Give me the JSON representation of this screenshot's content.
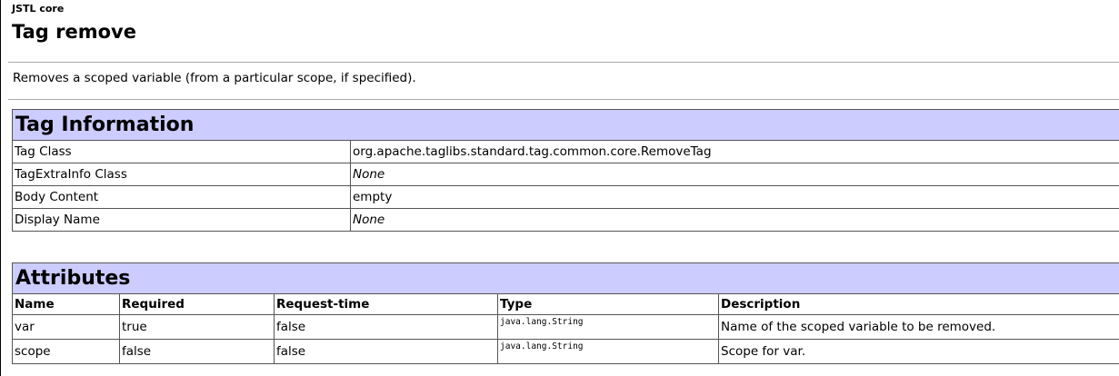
{
  "library": "JSTL core",
  "tag_title": "Tag remove",
  "description": "Removes a scoped variable (from a particular scope, if specified).",
  "tag_info": {
    "heading": "Tag Information",
    "rows": [
      {
        "label": "Tag Class",
        "value": "org.apache.taglibs.standard.tag.common.core.RemoveTag"
      },
      {
        "label": "TagExtraInfo Class",
        "value": "None"
      },
      {
        "label": "Body Content",
        "value": "empty"
      },
      {
        "label": "Display Name",
        "value": "None"
      }
    ]
  },
  "attributes": {
    "heading": "Attributes",
    "columns": [
      "Name",
      "Required",
      "Request-time",
      "Type",
      "Description"
    ],
    "rows": [
      {
        "name": "var",
        "required": "true",
        "request_time": "false",
        "type": "java.lang.String",
        "description": "Name of the scoped variable to be removed."
      },
      {
        "name": "scope",
        "required": "false",
        "request_time": "false",
        "type": "java.lang.String",
        "description": "Scope for var."
      }
    ]
  },
  "colors": {
    "section_header_bg": "#ccccff",
    "border": "#555555",
    "rule": "#aaaaaa"
  }
}
